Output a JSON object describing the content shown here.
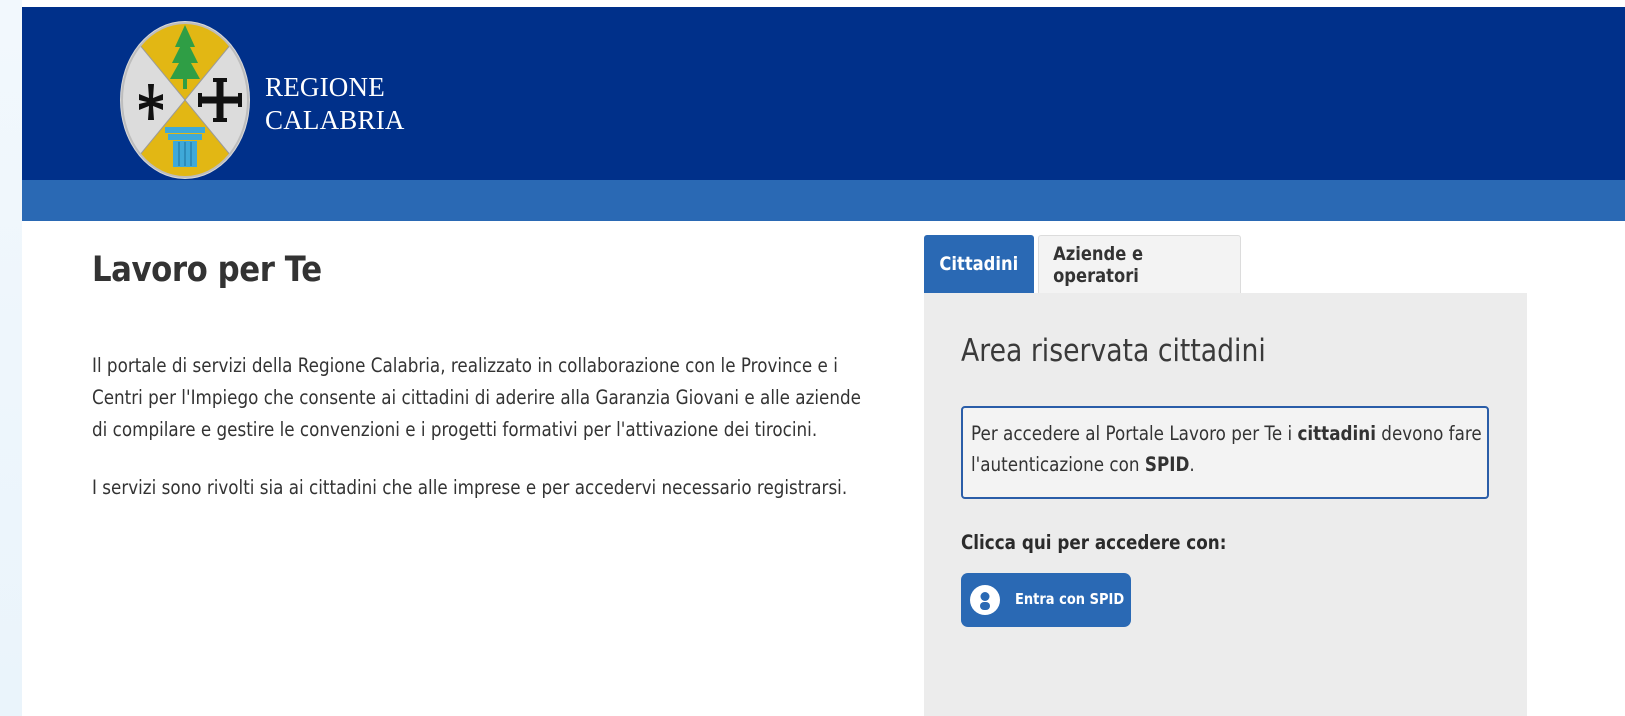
{
  "header": {
    "brand_line1": "REGIONE",
    "brand_line2": "CALABRIA"
  },
  "main": {
    "title": "Lavoro per Te",
    "intro_paragraph": "Il portale di servizi della Regione Calabria, realizzato in collaborazione con le Province e i Centri per l'Impiego che consente ai cittadini di aderire alla Garanzia Giovani e alle aziende di compilare e gestire le convenzioni e i progetti formativi per l'attivazione dei tirocini.",
    "services_paragraph": "I servizi sono rivolti sia ai cittadini che alle imprese e per accedervi necessario registrarsi."
  },
  "tabs": [
    {
      "label": "Cittadini",
      "active": true
    },
    {
      "label": "Aziende e operatori",
      "active": false
    }
  ],
  "panel": {
    "title": "Area riservata cittadini",
    "notice": {
      "text_1": "Per accedere al Portale Lavoro per Te i ",
      "bold_1": "cittadini",
      "text_2": " devono fare l'autenticazione con ",
      "bold_2": "SPID",
      "text_3": "."
    },
    "cta_label": "Clicca qui per accedere con:",
    "spid_button_label": "Entra con SPID"
  },
  "colors": {
    "header_bg": "#00308a",
    "subbar_bg": "#2a69b4",
    "accent": "#2a69b4",
    "panel_bg": "#ececec"
  },
  "icons": {
    "logo": "regione-calabria-coat-of-arms",
    "spid": "user-icon"
  }
}
